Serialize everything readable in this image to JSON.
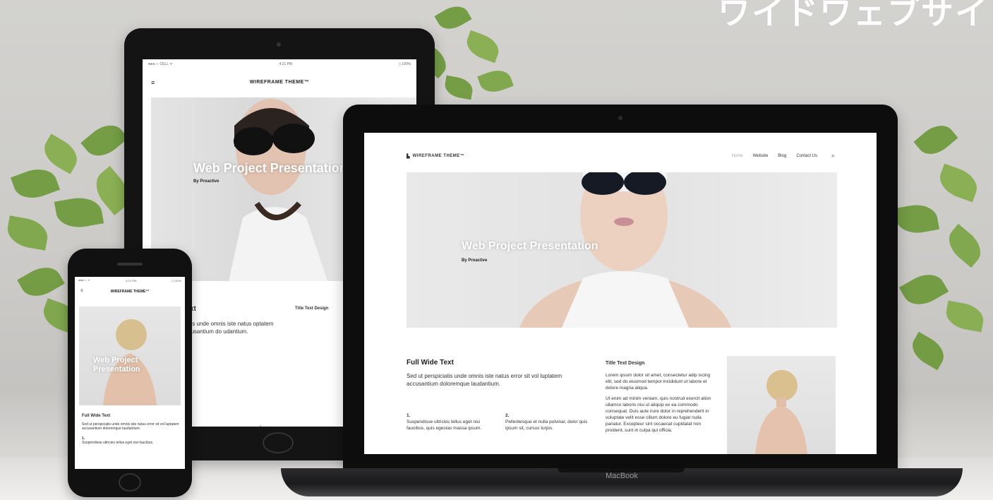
{
  "headline": "ワイドワェブサイ",
  "tablet": {
    "status_left": "●●●○○ CELL ᯤ",
    "status_time": "4:21 PM",
    "status_right": "▯ 100%",
    "site_title": "WIREFRAME THEME™",
    "hero_title": "Web Project Presentation",
    "hero_sub": "By Proactive",
    "body_heading": "Text",
    "body_text": "ciatis unde omnis iste natus optatem accusantium do udantium.",
    "side_heading": "Title Text Design"
  },
  "laptop": {
    "brand": "MacBook",
    "site_title": "WIREFRAME THEME™",
    "nav_links": [
      "Home",
      "Website",
      "Blog",
      "Contact Us"
    ],
    "hero_title": "Web Project Presentation",
    "hero_sub": "By Proactive",
    "full_wide_heading": "Full Wide Text",
    "full_wide_text": "Sed ut perspiciatis unde omnis iste natus error sit vol luptatem accusantium doloremque laudantium.",
    "item1_num": "1.",
    "item1_text": "Suspendisse ultricies tellus eget nisi faucibus, quis egestas massa ipsum.",
    "item2_num": "2.",
    "item2_text": "Pellentesque et nulla pulvinar, dolor quis ipsum sit, cursus turpis.",
    "title_design_heading": "Title Text Design",
    "title_design_p1": "Lorem ipsum dolor sit amet, consectetur adip iscing elit, sed do eiusmod tempor incididunt ut labore et dolore magna aliqua.",
    "title_design_p2": "Ut enim ad minim veniam, quis nostrud exercit ation ullamco laboris nisi ut aliquip ex ea commodo consequat. Duis aute irure dolor in reprehenderit in voluptate velit esse cillum dolore eu fugiat nulla pariatur. Excepteur sint occaecat cupidatat non proident, sunt in culpa qui officia."
  },
  "phone": {
    "status_left": "●●●○○ ᯤ",
    "status_time": "4:21 PM",
    "status_right": "▯ 100%",
    "site_title": "WIREFRAME THEME™",
    "hero_title": "Web Project Presentation",
    "body_heading": "Full Wide Text",
    "body_text": "Sed ut perspiciatis unde omnis iste natus error sit vol luptatem accusantium doloremque laudantium.",
    "item_num": "1.",
    "item_text": "Suspendisse ultricies tellus eget nisi faucibus."
  },
  "colors": {
    "leaf": "#6f9a3e",
    "device": "#141414",
    "hero_bg": "#e6e6e6"
  }
}
